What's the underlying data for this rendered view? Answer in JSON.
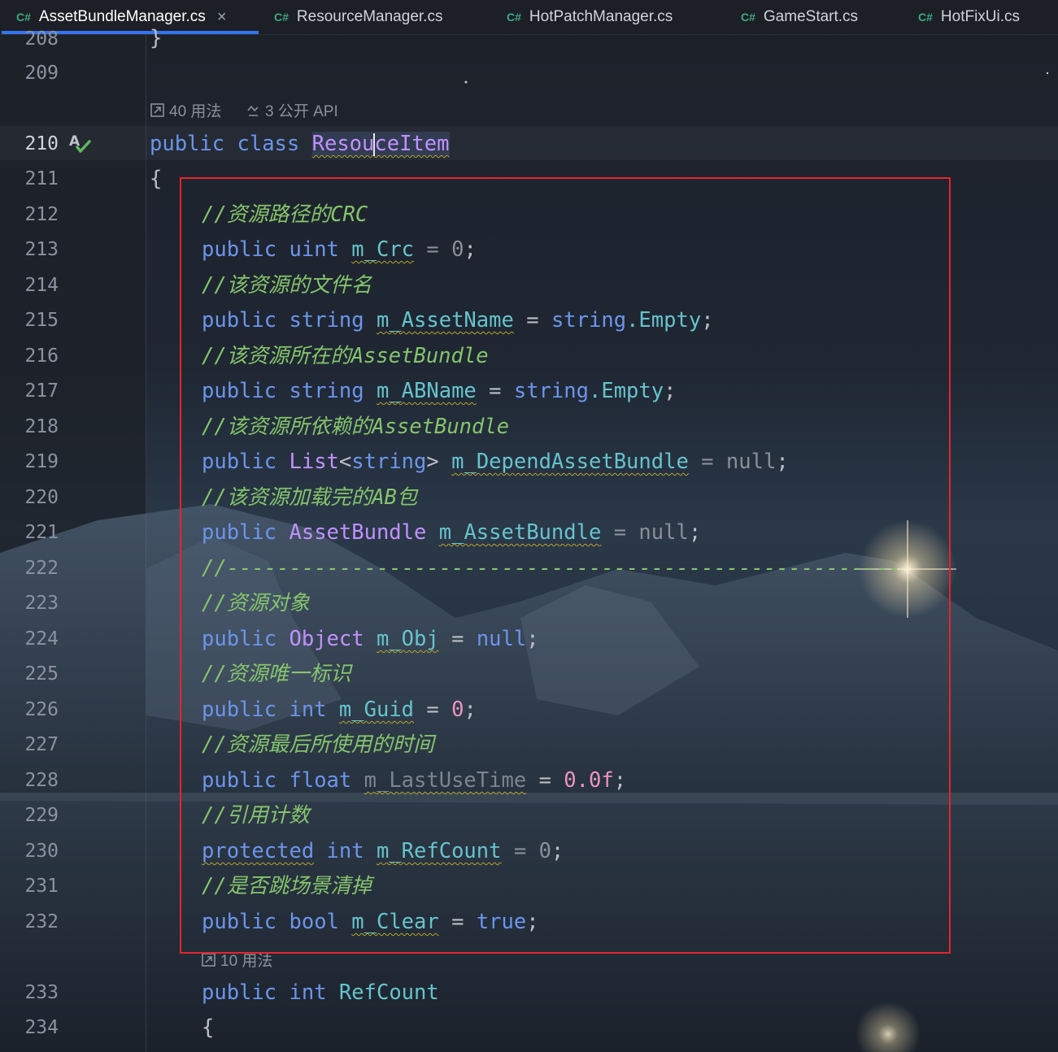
{
  "tabs": [
    {
      "lang": "C#",
      "name": "AssetBundleManager.cs",
      "active": true,
      "close": "×"
    },
    {
      "lang": "C#",
      "name": "ResourceManager.cs"
    },
    {
      "lang": "C#",
      "name": "HotPatchManager.cs"
    },
    {
      "lang": "C#",
      "name": "GameStart.cs"
    },
    {
      "lang": "C#",
      "name": "HotFixUi.cs"
    }
  ],
  "hints": {
    "class_usages": "40 用法",
    "class_api": "3 公开 API",
    "refcount_usages": "10 用法"
  },
  "line_numbers": [
    "208",
    "209",
    "210",
    "211",
    "212",
    "213",
    "214",
    "215",
    "216",
    "217",
    "218",
    "219",
    "220",
    "221",
    "222",
    "223",
    "224",
    "225",
    "226",
    "227",
    "228",
    "229",
    "230",
    "231",
    "232",
    "233",
    "234"
  ],
  "current_line": "210",
  "code": {
    "l208": "}",
    "l210": {
      "kw1": "public",
      "kw2": "class",
      "name_a": "Resou",
      "name_b": "ceItem"
    },
    "l211": "{",
    "l212": "//资源路径的CRC",
    "l213": {
      "kw": "public",
      "type": "uint",
      "field": "m_Crc",
      "op": "=",
      "val": "0",
      "end": ";"
    },
    "l214": "//该资源的文件名",
    "l215": {
      "kw": "public",
      "type": "string",
      "field": "m_AssetName",
      "op": "=",
      "val_a": "string",
      "val_b": ".Empty",
      "end": ";"
    },
    "l216": "//该资源所在的AssetBundle",
    "l217": {
      "kw": "public",
      "type": "string",
      "field": "m_ABName",
      "op": "=",
      "val_a": "string",
      "val_b": ".Empty",
      "end": ";"
    },
    "l218": "//该资源所依赖的AssetBundle",
    "l219": {
      "kw": "public",
      "type_a": "List",
      "lt": "<",
      "type_b": "string",
      "gt": ">",
      "field": "m_DependAssetBundle",
      "op": "=",
      "val": "null",
      "end": ";"
    },
    "l220": "//该资源加载完的AB包",
    "l221": {
      "kw": "public",
      "type": "AssetBundle",
      "field": "m_AssetBundle",
      "op": "=",
      "val": "null",
      "end": ";"
    },
    "l222": "//------------------------------------------------------",
    "l223": "//资源对象",
    "l224": {
      "kw": "public",
      "type": "Object",
      "field": "m_Obj",
      "op": "=",
      "val": "null",
      "end": ";"
    },
    "l225": "//资源唯一标识",
    "l226": {
      "kw": "public",
      "type": "int",
      "field": "m_Guid",
      "op": "=",
      "val": "0",
      "end": ";"
    },
    "l227": "//资源最后所使用的时间",
    "l228": {
      "kw": "public",
      "type": "float",
      "field": "m_LastUseTime",
      "op": "=",
      "val": "0.0f",
      "end": ";"
    },
    "l229": "//引用计数",
    "l230": {
      "kw": "protected",
      "type": "int",
      "field": "m_RefCount",
      "op": "=",
      "val": "0",
      "end": ";"
    },
    "l231": "//是否跳场景清掉",
    "l232": {
      "kw": "public",
      "type": "bool",
      "field": "m_Clear",
      "op": "=",
      "val": "true",
      "end": ";"
    },
    "l233": {
      "kw": "public",
      "type": "int",
      "name": "RefCount"
    },
    "l234": "{"
  },
  "colors": {
    "keyword": "#6c95eb",
    "type": "#c191ff",
    "field": "#66c3cc",
    "number": "#ed94c0",
    "comment": "#85c46c",
    "highlight_box": "#e5242c",
    "active_tab_underline": "#3574f0"
  }
}
